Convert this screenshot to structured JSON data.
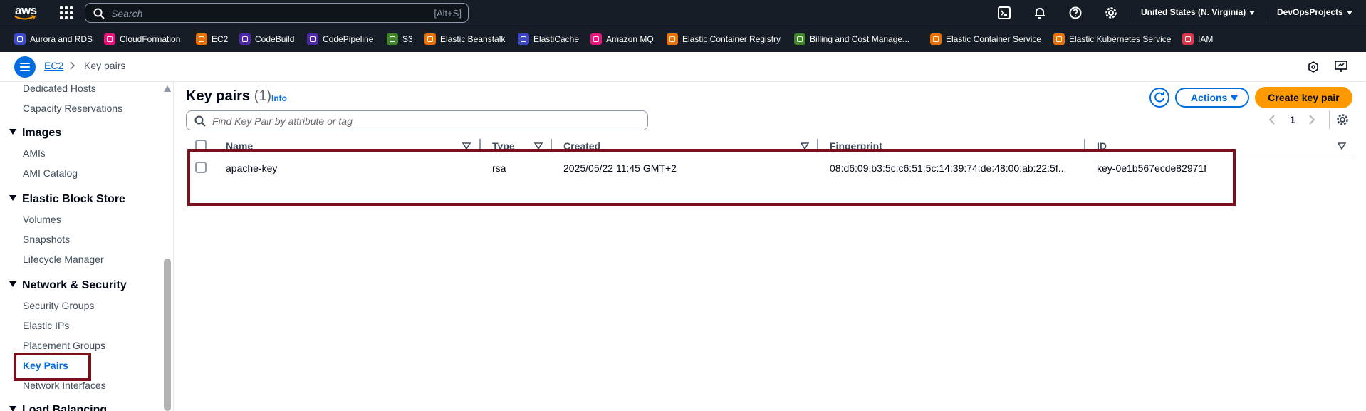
{
  "topbar": {
    "logo_text": "aws",
    "search_placeholder": "Search",
    "search_shortcut": "[Alt+S]",
    "region": "United States (N. Virginia)",
    "account": "DevOpsProjects"
  },
  "favorites": [
    {
      "label": "Aurora and RDS",
      "color": "#3b48cc"
    },
    {
      "label": "CloudFormation",
      "color": "#e7157b"
    },
    {
      "label": "EC2",
      "color": "#ed7100"
    },
    {
      "label": "CodeBuild",
      "color": "#4d27aa"
    },
    {
      "label": "CodePipeline",
      "color": "#4d27aa"
    },
    {
      "label": "S3",
      "color": "#3f8624"
    },
    {
      "label": "Elastic Beanstalk",
      "color": "#ed7100"
    },
    {
      "label": "ElastiCache",
      "color": "#3b48cc"
    },
    {
      "label": "Amazon MQ",
      "color": "#e7157b"
    },
    {
      "label": "Elastic Container Registry",
      "color": "#ed7100"
    },
    {
      "label": "Billing and Cost Manage...",
      "color": "#3f8624"
    },
    {
      "label": "Elastic Container Service",
      "color": "#ed7100"
    },
    {
      "label": "Elastic Kubernetes Service",
      "color": "#ed7100"
    },
    {
      "label": "IAM",
      "color": "#dd344c"
    }
  ],
  "breadcrumb": {
    "parent": "EC2",
    "current": "Key pairs"
  },
  "sidebar": {
    "items_top": [
      "Dedicated Hosts",
      "Capacity Reservations"
    ],
    "sections": [
      {
        "title": "Images",
        "items": [
          "AMIs",
          "AMI Catalog"
        ]
      },
      {
        "title": "Elastic Block Store",
        "items": [
          "Volumes",
          "Snapshots",
          "Lifecycle Manager"
        ]
      },
      {
        "title": "Network & Security",
        "items": [
          "Security Groups",
          "Elastic IPs",
          "Placement Groups",
          "Key Pairs",
          "Network Interfaces"
        ]
      },
      {
        "title": "Load Balancing",
        "items": []
      }
    ],
    "active_item": "Key Pairs"
  },
  "main": {
    "title": "Key pairs",
    "count": "(1)",
    "info": "Info",
    "actions_label": "Actions",
    "create_label": "Create key pair",
    "filter_placeholder": "Find Key Pair by attribute or tag",
    "page_number": "1",
    "columns": [
      "Name",
      "Type",
      "Created",
      "Fingerprint",
      "ID"
    ],
    "rows": [
      {
        "name": "apache-key",
        "type": "rsa",
        "created": "2025/05/22 11:45 GMT+2",
        "fingerprint": "08:d6:09:b3:5c:c6:51:5c:14:39:74:de:48:00:ab:22:5f...",
        "id": "key-0e1b567ecde82971f"
      }
    ]
  },
  "colors": {
    "topbar_bg": "#161d26",
    "link_blue": "#006ce0",
    "primary_orange": "#ff9900",
    "highlight_red": "#7a0f1c"
  }
}
